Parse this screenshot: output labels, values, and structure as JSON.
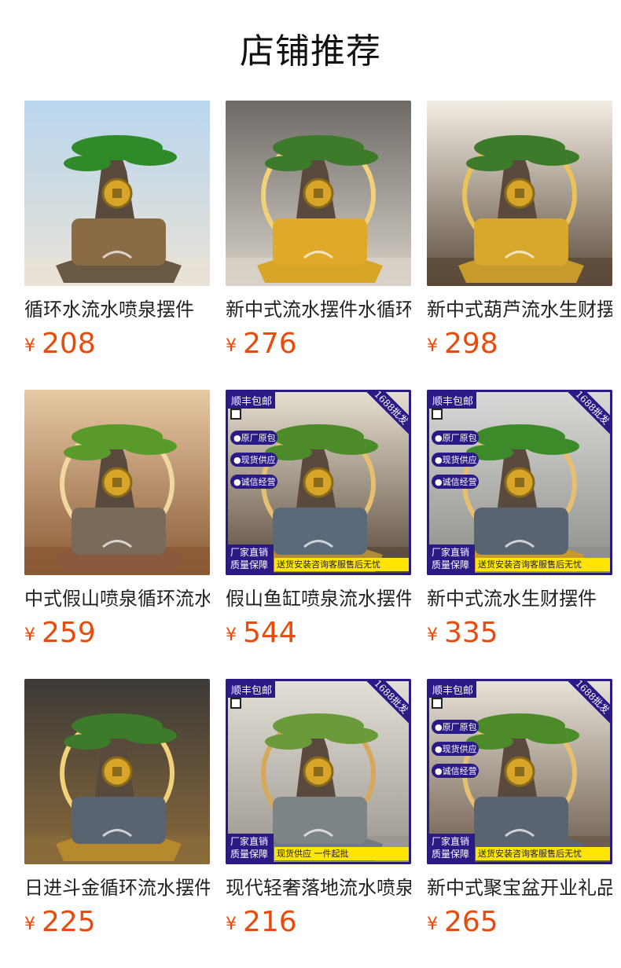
{
  "page": {
    "title": "店铺推荐"
  },
  "products": [
    {
      "name": "循环水流水喷泉摆件",
      "currency": "¥",
      "price": "208",
      "badge": null
    },
    {
      "name": "新中式流水摆件水循环",
      "currency": "¥",
      "price": "276",
      "badge": null
    },
    {
      "name": "新中式葫芦流水生财摆件",
      "currency": "¥",
      "price": "298",
      "badge": null
    },
    {
      "name": "中式假山喷泉循环流水",
      "currency": "¥",
      "price": "259",
      "badge": null
    },
    {
      "name": "假山鱼缸喷泉流水摆件",
      "currency": "¥",
      "price": "544",
      "badge": {
        "top_left": "顺丰包邮",
        "ribbon": "1688批发",
        "features": [
          "●原厂原包",
          "●现货供应",
          "●诚信经营"
        ],
        "bottom_left": "厂家直销 质量保障",
        "bottom_strip": "送货安装咨询客服售后无忧"
      }
    },
    {
      "name": "新中式流水生财摆件",
      "currency": "¥",
      "price": "335",
      "badge": {
        "top_left": "顺丰包邮",
        "ribbon": "1688批发",
        "features": [
          "●原厂原包",
          "●现货供应",
          "●诚信经营"
        ],
        "bottom_left": "厂家直销 质量保障",
        "bottom_strip": "送货安装咨询客服售后无忧"
      }
    },
    {
      "name": "日进斗金循环流水摆件",
      "currency": "¥",
      "price": "225",
      "badge": null
    },
    {
      "name": "现代轻奢落地流水喷泉",
      "currency": "¥",
      "price": "216",
      "badge": {
        "top_left": "顺丰包邮",
        "ribbon": "1688批发",
        "features": [],
        "bottom_left": "厂家直销 质量保障",
        "bottom_strip": "现货供应 一件起批"
      }
    },
    {
      "name": "新中式聚宝盆开业礼品",
      "currency": "¥",
      "price": "265",
      "badge": {
        "top_left": "顺丰包邮",
        "ribbon": "1688批发",
        "features": [
          "●原厂原包",
          "●现货供应",
          "●诚信经营"
        ],
        "bottom_left": "厂家直销 质量保障",
        "bottom_strip": "送货安装咨询客服售后无忧"
      }
    }
  ],
  "theme": {
    "price_color": "#ea4b0c",
    "badge_color": "#2b1a86",
    "strip_color": "#ffe500"
  }
}
